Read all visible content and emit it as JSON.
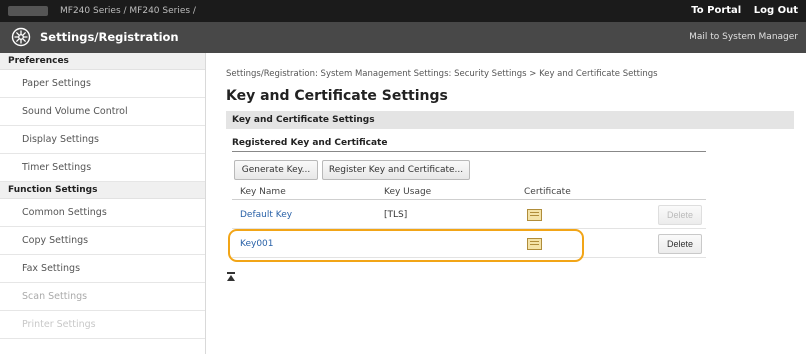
{
  "header": {
    "model": "MF240 Series / MF240 Series /",
    "links": [
      "To Portal",
      "Log Out"
    ],
    "title": "Settings/Registration",
    "mail_link": "Mail to System Manager"
  },
  "sidebar": {
    "preferences_header": "Preferences",
    "preferences_items": [
      "Paper Settings",
      "Sound Volume Control",
      "Display Settings",
      "Timer Settings"
    ],
    "function_header": "Function Settings",
    "function_items": [
      "Common Settings",
      "Copy Settings",
      "Fax Settings",
      "Scan Settings",
      "Printer Settings"
    ]
  },
  "main": {
    "breadcrumb": "Settings/Registration: System Management Settings: Security Settings > Key and Certificate Settings",
    "title": "Key and Certificate Settings",
    "section": "Key and Certificate Settings",
    "subsection": "Registered Key and Certificate",
    "buttons": {
      "generate": "Generate Key...",
      "register": "Register Key and Certificate..."
    },
    "table": {
      "headers": [
        "Key Name",
        "Key Usage",
        "Certificate"
      ],
      "rows": [
        {
          "name": "Default Key",
          "usage": "[TLS]",
          "delete": "Delete"
        },
        {
          "name": "Key001",
          "usage": "",
          "delete": "Delete"
        }
      ]
    }
  },
  "colors": {
    "top_bar": "#1b1b1b",
    "title_bar": "#484848",
    "link": "#2a62a8",
    "highlight": "#f2a517"
  },
  "icons": {
    "title": "settings-gear-icon",
    "certificate": "certificate-icon",
    "back_to_top": "back-to-top-icon"
  }
}
